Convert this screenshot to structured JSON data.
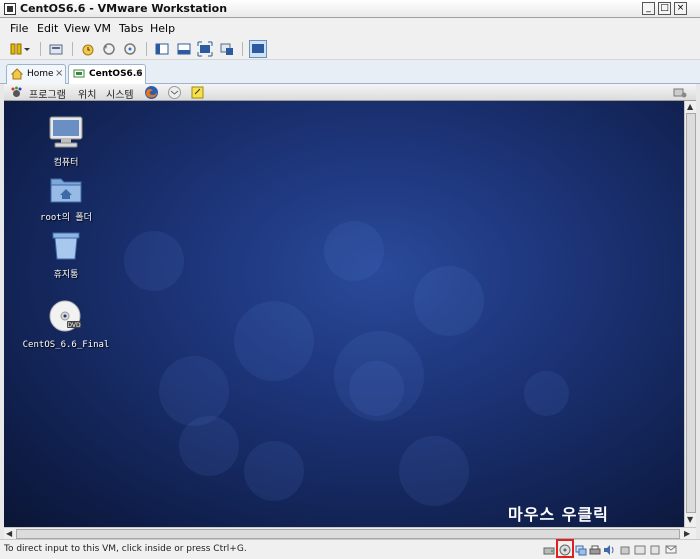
{
  "window": {
    "title": "CentOS6.6 - VMware Workstation",
    "min_label": "_",
    "max_label": "□",
    "close_label": "×"
  },
  "menu": [
    "File",
    "Edit",
    "View",
    "VM",
    "Tabs",
    "Help"
  ],
  "toolbar": {
    "icons": [
      "pause-icon",
      "dropdown-icon",
      "send-ctrl-alt-del-icon",
      "snapshot-icon",
      "revert-snapshot-icon",
      "snapshot-manager-icon",
      "show-library-icon",
      "quick-switch-icon",
      "full-screen-icon",
      "unity-icon",
      "console-view-icon"
    ]
  },
  "tabs": [
    {
      "label": "Home",
      "close": "×"
    },
    {
      "label": "CentOS6.6",
      "close": "×"
    }
  ],
  "guest_panel": {
    "applications": "프로그램",
    "places": "위치",
    "system": "시스템"
  },
  "desktop": {
    "icons": [
      {
        "label": "컴퓨터",
        "icon": "computer-icon"
      },
      {
        "label": "root의 폴더",
        "icon": "home-folder-icon"
      },
      {
        "label": "휴지통",
        "icon": "trash-icon"
      },
      {
        "label": "CentOS_6.6_Final",
        "icon": "dvd-icon"
      }
    ],
    "annotation": "마우스 우클릭"
  },
  "statusbar": {
    "text": "To direct input to this VM, click inside or press Ctrl+G."
  },
  "colors": {
    "desktop_blue": "#1d357a",
    "highlight": "#e02020"
  }
}
